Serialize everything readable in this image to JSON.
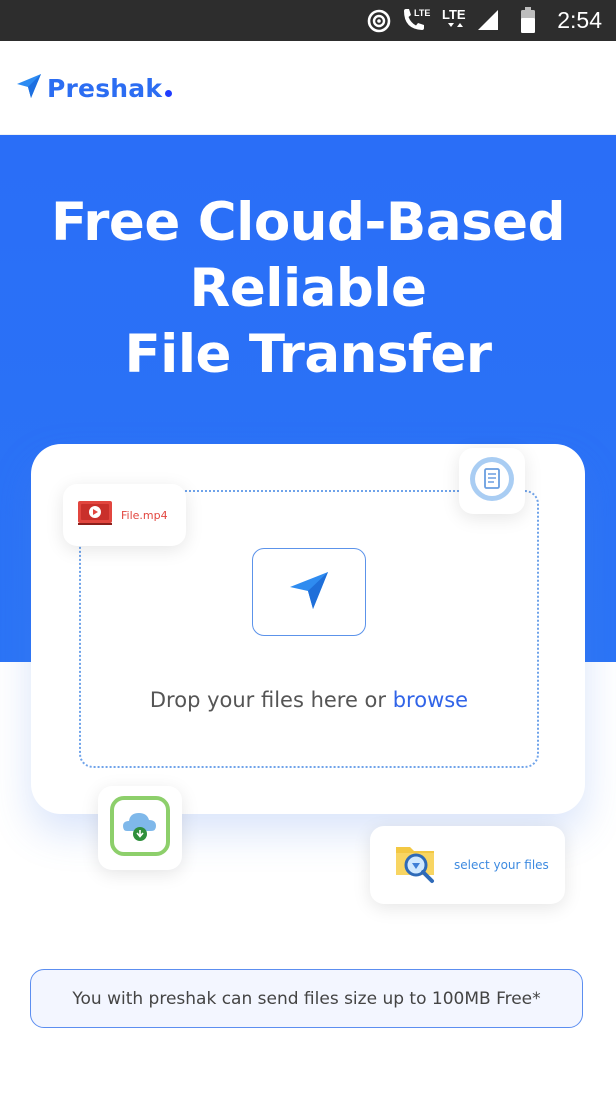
{
  "status_bar": {
    "time": "2:54",
    "lte1": "LTE",
    "lte2": "LTE"
  },
  "header": {
    "brand": "Preshak",
    "logo_icon": "paper-plane-icon"
  },
  "hero": {
    "title_line1": "Free Cloud-Based",
    "title_line2": "Reliable",
    "title_line3": "File Transfer"
  },
  "upload": {
    "drop_text": "Drop your files here or ",
    "browse_label": "browse",
    "file_chip_label": "File.mp4",
    "select_chip_label": "select your files"
  },
  "note": {
    "text": "You with preshak can send files size up to 100MB Free*"
  },
  "colors": {
    "accent": "#2c6df2",
    "hero_bg": "#2a6ef7",
    "file_red": "#e2463f",
    "cloud_green": "#8dcf6b"
  }
}
